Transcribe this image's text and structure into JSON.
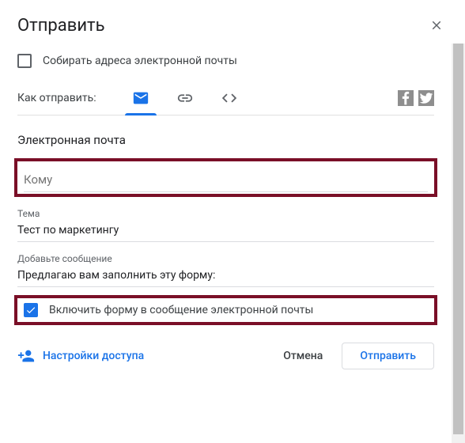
{
  "dialog": {
    "title": "Отправить"
  },
  "collect": {
    "label": "Собирать адреса электронной почты",
    "checked": false
  },
  "sendhow": {
    "label": "Как отправить:",
    "tabs": [
      {
        "name": "email",
        "active": true
      },
      {
        "name": "link",
        "active": false
      },
      {
        "name": "embed",
        "active": false
      }
    ]
  },
  "email": {
    "section_title": "Электронная почта",
    "to_placeholder": "Кому",
    "to_value": "",
    "subject_label": "Тема",
    "subject_value": "Тест по маркетингу",
    "message_label": "Добавьте сообщение",
    "message_value": "Предлагаю вам заполнить эту форму:",
    "include_form_label": "Включить форму в сообщение электронной почты",
    "include_form_checked": true
  },
  "access": {
    "label": "Настройки доступа"
  },
  "buttons": {
    "cancel": "Отмена",
    "send": "Отправить"
  },
  "colors": {
    "accent": "#1a73e8",
    "highlight": "#7a0f27"
  }
}
